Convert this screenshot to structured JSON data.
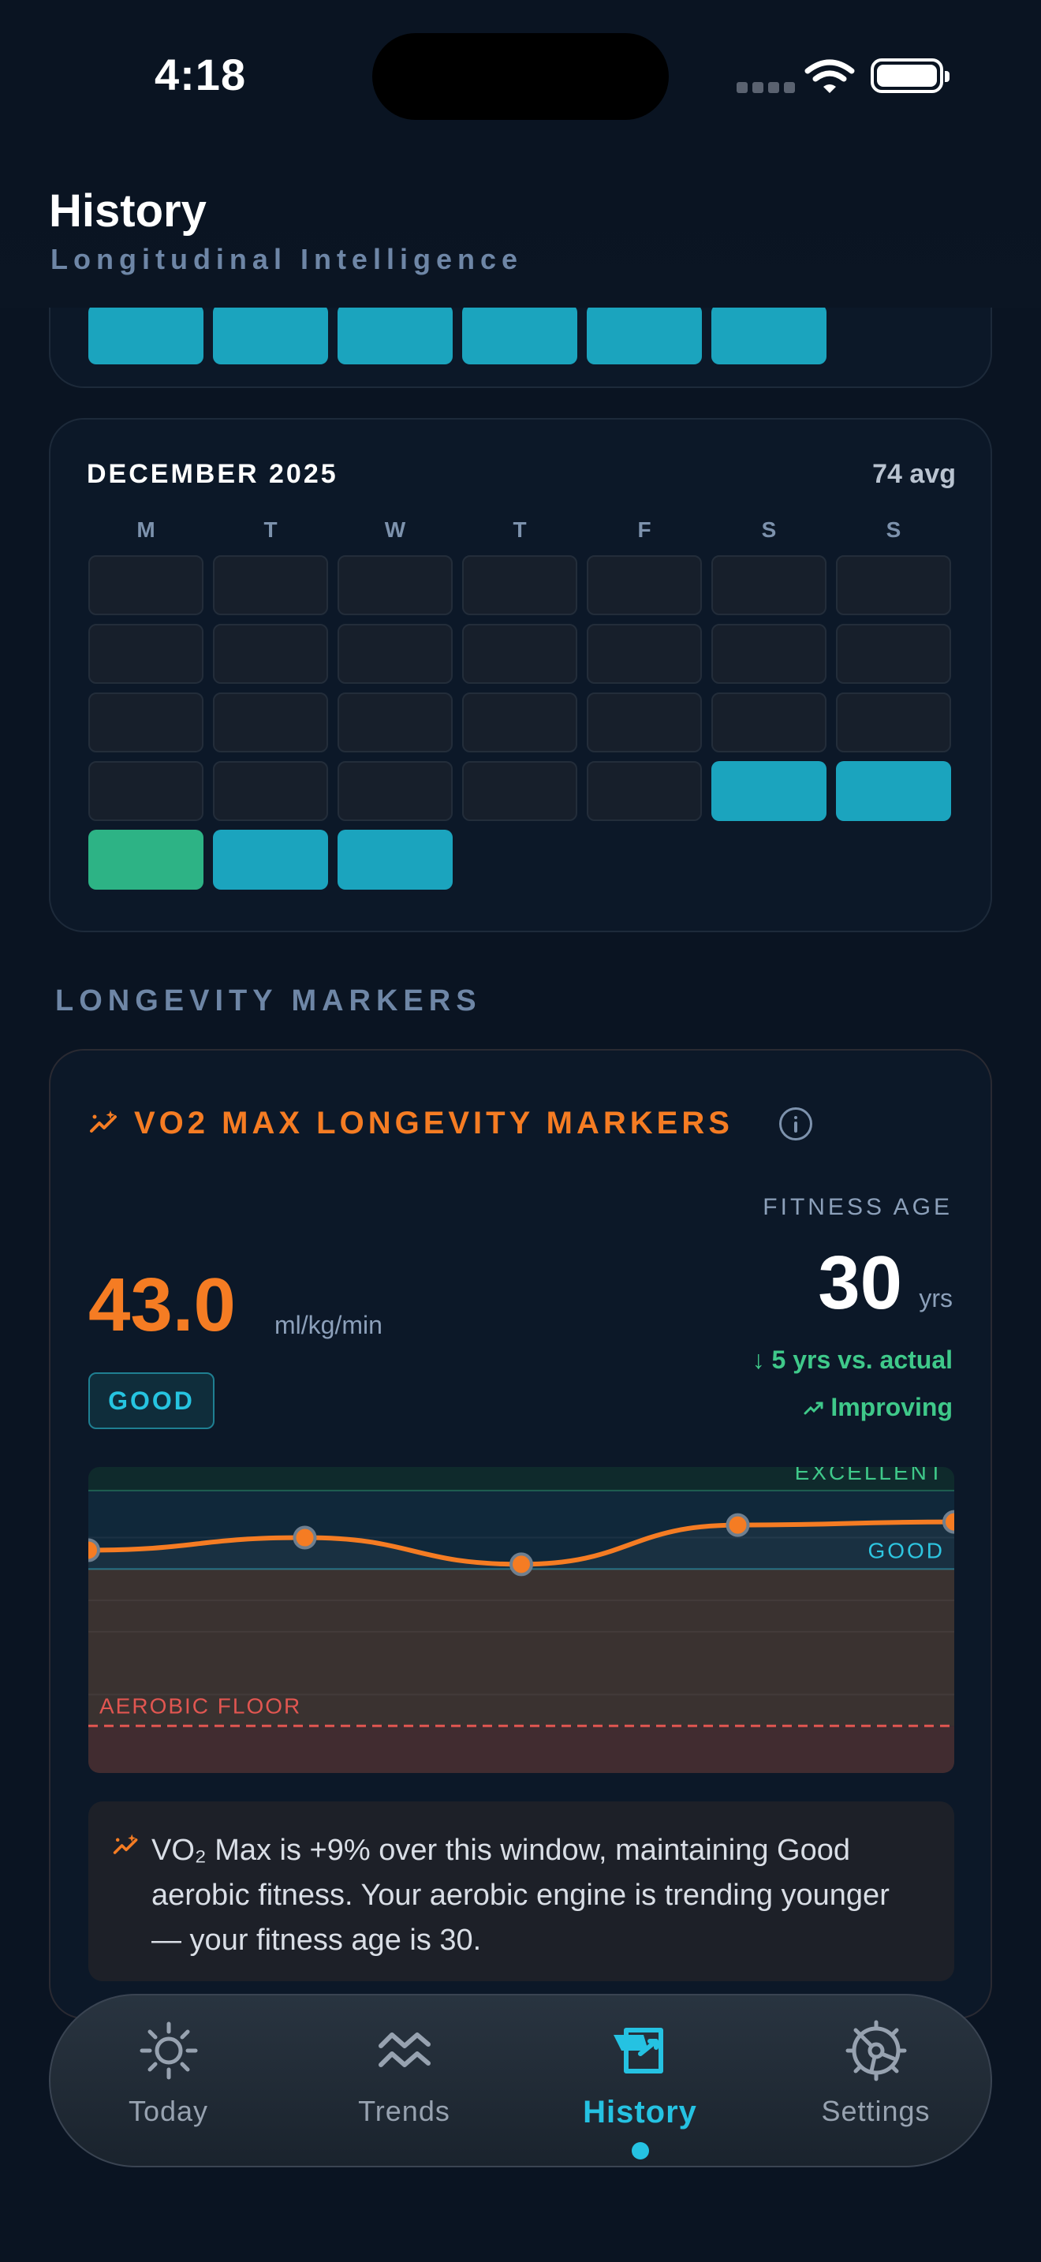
{
  "status_bar": {
    "time": "4:18"
  },
  "header": {
    "title": "History",
    "subtitle": "Longitudinal Intelligence"
  },
  "top_card": {
    "tiles": [
      "teal",
      "teal",
      "teal",
      "teal",
      "teal",
      "teal"
    ]
  },
  "december": {
    "title": "DECEMBER 2025",
    "avg": "74 avg",
    "weekdays": [
      "M",
      "T",
      "W",
      "T",
      "F",
      "S",
      "S"
    ],
    "rows": [
      [
        "empty",
        "empty",
        "empty",
        "empty",
        "empty",
        "empty",
        "empty"
      ],
      [
        "empty",
        "empty",
        "empty",
        "empty",
        "empty",
        "empty",
        "empty"
      ],
      [
        "empty",
        "empty",
        "empty",
        "empty",
        "empty",
        "empty",
        "empty"
      ],
      [
        "empty",
        "empty",
        "empty",
        "empty",
        "empty",
        "teal",
        "teal"
      ],
      [
        "green",
        "teal",
        "teal",
        "blank",
        "blank",
        "blank",
        "blank"
      ]
    ]
  },
  "section_label": "LONGEVITY MARKERS",
  "vo2": {
    "title": "VO2 MAX LONGEVITY MARKERS",
    "value": "43.0",
    "unit": "ml/kg/min",
    "badge": "GOOD",
    "fitness_age_label": "FITNESS AGE",
    "fitness_age": "30",
    "fitness_age_unit": "yrs",
    "delta": "↓ 5 yrs vs. actual",
    "trend": "Improving",
    "insight": "VO₂ Max is +9% over this window, maintaining Good aerobic fitness. Your aerobic engine is trending younger — your fitness age is 30.",
    "colors": {
      "accent": "#f57c23",
      "good": "#26c4e0",
      "excellent": "#3fc98a",
      "floor": "#e0504a"
    }
  },
  "chart_data": {
    "type": "line",
    "x": [
      1,
      2,
      3,
      4,
      5
    ],
    "series": [
      {
        "values": [
          41.2,
          42.0,
          40.3,
          42.8,
          43.0
        ]
      }
    ],
    "bands": [
      {
        "label": "EXCELLENT",
        "from": 45.0,
        "to": 50
      },
      {
        "label": "GOOD",
        "from": 40.0,
        "to": 45.0
      },
      {
        "label": "AEROBIC FLOOR",
        "value": 30.0
      }
    ],
    "ylim": [
      27,
      46.5
    ],
    "grid": true
  },
  "tabs": [
    {
      "label": "Today",
      "icon": "sun-icon",
      "active": false
    },
    {
      "label": "Trends",
      "icon": "trends-icon",
      "active": false
    },
    {
      "label": "History",
      "icon": "history-icon",
      "active": true
    },
    {
      "label": "Settings",
      "icon": "gear-icon",
      "active": false
    }
  ]
}
